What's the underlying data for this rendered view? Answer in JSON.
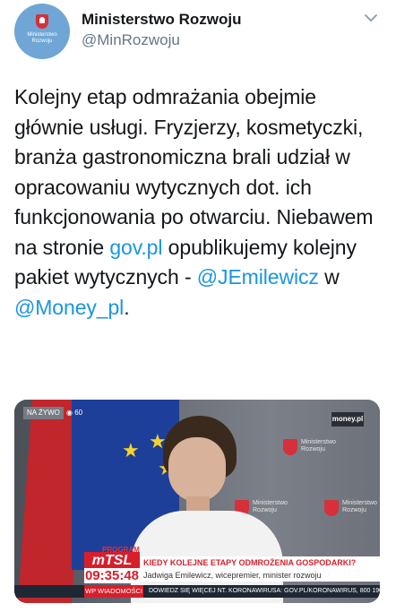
{
  "account": {
    "name": "Ministerstwo Rozwoju",
    "handle": "@MinRozwoju",
    "avatar_text": "Ministerstwo Rozwoju"
  },
  "tweet": {
    "text_before": "Kolejny etap odmrażania obejmie głównie usługi. Fryzjerzy, kosmetyczki, branża gastronomiczna brali udział w opracowaniu wytycznych dot. ich funkcjonowania po otwarciu. Niebawem na stronie ",
    "link_site": "gov.pl",
    "text_middle": " opublikujemy kolejny pakiet wytycznych - ",
    "mention_1": "@JEmilewicz",
    "text_w": " w ",
    "mention_2": "@Money_pl",
    "text_end": "."
  },
  "video": {
    "live_label": "NA ŻYWO",
    "view_count": "60",
    "channel_logo": "money.pl",
    "backdrop_logo_text": "Ministerstwo Rozwoju",
    "program_label": "PROGRAM",
    "program_name": "mTSL",
    "clock": "09:35:48",
    "headline": "KIEDY KOLEJNE ETAPY ODMROŻENIA GOSPODARKI?",
    "speaker": "Jadwiga Emilewicz, wicepremier, minister rozwoju",
    "ticker_left": "WP WIADOMOŚCI",
    "ticker_text": "DOWIEDZ SIĘ WIĘCEJ NT. KORONAWIRUSA: GOV.PL/KORONAWIRUS, 800 190 590"
  },
  "icons": {
    "menu": "chevron-down-icon",
    "views": "eye-icon"
  },
  "colors": {
    "link": "#1b95e0",
    "text": "#14171a",
    "muted": "#657786",
    "accent_red": "#d71f2b"
  }
}
